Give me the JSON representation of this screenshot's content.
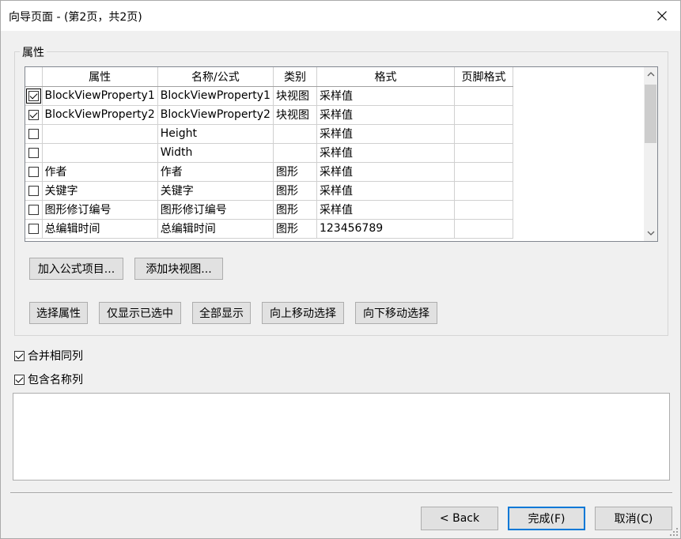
{
  "window": {
    "title": "向导页面 - (第2页，共2页)"
  },
  "group": {
    "label": "属性",
    "columns": [
      "",
      "属性",
      "名称/公式",
      "类别",
      "格式",
      "页脚格式"
    ],
    "rows": [
      {
        "checked": true,
        "focused": true,
        "attr": "BlockViewProperty1",
        "name": "BlockViewProperty1",
        "category": "块视图",
        "format": "采样值",
        "footer": ""
      },
      {
        "checked": true,
        "focused": false,
        "attr": "BlockViewProperty2",
        "name": "BlockViewProperty2",
        "category": "块视图",
        "format": "采样值",
        "footer": ""
      },
      {
        "checked": false,
        "focused": false,
        "attr": "",
        "name": "Height",
        "category": "",
        "format": "采样值",
        "footer": ""
      },
      {
        "checked": false,
        "focused": false,
        "attr": "",
        "name": "Width",
        "category": "",
        "format": "采样值",
        "footer": ""
      },
      {
        "checked": false,
        "focused": false,
        "attr": "作者",
        "name": "作者",
        "category": "图形",
        "format": "采样值",
        "footer": ""
      },
      {
        "checked": false,
        "focused": false,
        "attr": "关键字",
        "name": "关键字",
        "category": "图形",
        "format": "采样值",
        "footer": ""
      },
      {
        "checked": false,
        "focused": false,
        "attr": "图形修订编号",
        "name": "图形修订编号",
        "category": "图形",
        "format": "采样值",
        "footer": ""
      },
      {
        "checked": false,
        "focused": false,
        "attr": "总编辑时间",
        "name": "总编辑时间",
        "category": "图形",
        "format": "123456789",
        "footer": ""
      }
    ],
    "buttons": {
      "add_formula": "加入公式项目...",
      "add_block_view": "添加块视图...",
      "select_attr": "选择属性",
      "show_selected": "仅显示已选中",
      "show_all": "全部显示",
      "move_up": "向上移动选择",
      "move_down": "向下移动选择"
    }
  },
  "options": {
    "merge_columns": {
      "label": "合并相同列",
      "checked": true
    },
    "include_name": {
      "label": "包含名称列",
      "checked": true
    }
  },
  "footer": {
    "back": "< Back",
    "finish": "完成(F)",
    "cancel": "取消(C)"
  }
}
